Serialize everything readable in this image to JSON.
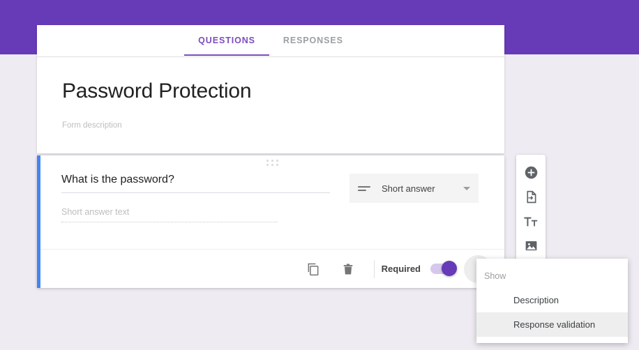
{
  "app": {
    "accent_purple": "#673AB7",
    "tab_purple": "#7C4DBE",
    "selected_card_accent": "#4285F4",
    "page_background": "#EFEBF2"
  },
  "tabs": [
    {
      "label": "QUESTIONS",
      "active": true
    },
    {
      "label": "RESPONSES",
      "active": false
    }
  ],
  "form": {
    "title": "Password Protection",
    "description_placeholder": "Form description"
  },
  "question": {
    "drag_handle_icon": "drag-dots-icon",
    "title": "What is the password?",
    "answer_placeholder": "Short answer text",
    "type": {
      "icon": "short-answer-lines-icon",
      "selected": "Short answer",
      "caret_icon": "chevron-down-icon"
    },
    "footer": {
      "duplicate_icon": "duplicate-icon",
      "delete_icon": "trash-icon",
      "required_label": "Required",
      "required_on": true,
      "more_icon": "more-vert-icon"
    }
  },
  "side_toolbar": {
    "items": [
      {
        "icon": "add-circle-icon",
        "name": "add-question-button"
      },
      {
        "icon": "import-questions-icon",
        "name": "import-questions-button"
      },
      {
        "icon": "title-text-icon",
        "name": "add-title-button"
      },
      {
        "icon": "image-icon",
        "name": "add-image-button"
      }
    ]
  },
  "show_menu": {
    "header": "Show",
    "items": [
      {
        "label": "Description",
        "highlighted": false
      },
      {
        "label": "Response validation",
        "highlighted": true
      }
    ]
  }
}
